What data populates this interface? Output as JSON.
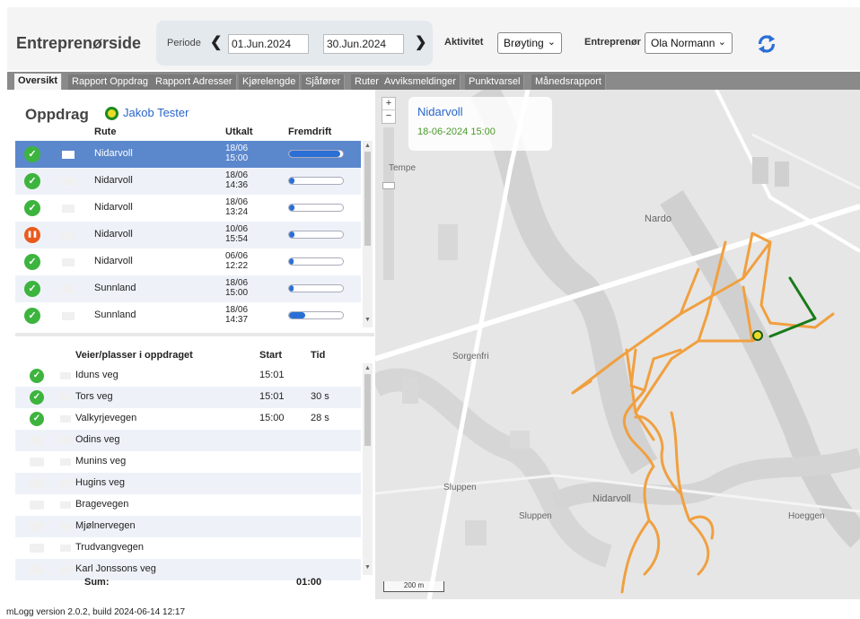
{
  "header": {
    "title": "Entreprenørside",
    "periode_label": "Periode",
    "date_from": "01.Jun.2024",
    "date_to": "30.Jun.2024",
    "aktivitet_label": "Aktivitet",
    "aktivitet_value": "Brøyting",
    "entreprenor_label": "Entreprenør",
    "entreprenor_value": "Ola Normann"
  },
  "tabs": [
    {
      "label": "Oversikt",
      "active": true
    },
    {
      "label": "Rapport Oppdrag"
    },
    {
      "label": "Rapport Adresser"
    },
    {
      "label": "Kjørelengde"
    },
    {
      "label": "Sjåfører"
    },
    {
      "label": "Ruter"
    },
    {
      "label": "Avviksmeldinger"
    },
    {
      "label": "Punktvarsel"
    },
    {
      "label": "Månedsrapport"
    }
  ],
  "oppdrag": {
    "title": "Oppdrag",
    "user": "Jakob Tester",
    "columns": {
      "rute": "Rute",
      "utkalt": "Utkalt",
      "fremdrift": "Fremdrift"
    },
    "rows": [
      {
        "status": "ok",
        "rute": "Nidarvoll",
        "date": "18/06",
        "time": "15:00",
        "progress": 0.95,
        "selected": true
      },
      {
        "status": "ok",
        "rute": "Nidarvoll",
        "date": "18/06",
        "time": "14:36",
        "progress": 0.1
      },
      {
        "status": "ok",
        "rute": "Nidarvoll",
        "date": "18/06",
        "time": "13:24",
        "progress": 0.1
      },
      {
        "status": "pause",
        "rute": "Nidarvoll",
        "date": "10/06",
        "time": "15:54",
        "progress": 0.1
      },
      {
        "status": "ok",
        "rute": "Nidarvoll",
        "date": "06/06",
        "time": "12:22",
        "progress": 0.05
      },
      {
        "status": "ok",
        "rute": "Sunnland",
        "date": "18/06",
        "time": "15:00",
        "progress": 0.05
      },
      {
        "status": "ok",
        "rute": "Sunnland",
        "date": "18/06",
        "time": "14:37",
        "progress": 0.3
      }
    ]
  },
  "veier": {
    "columns": {
      "vei": "Veier/plasser i oppdraget",
      "start": "Start",
      "tid": "Tid"
    },
    "rows": [
      {
        "status": "ok",
        "vei": "Iduns veg",
        "start": "15:01",
        "tid": ""
      },
      {
        "status": "ok",
        "vei": "Tors veg",
        "start": "15:01",
        "tid": "30 s"
      },
      {
        "status": "ok",
        "vei": "Valkyrjevegen",
        "start": "15:00",
        "tid": "28 s"
      },
      {
        "status": "none",
        "vei": "Odins veg",
        "start": "",
        "tid": ""
      },
      {
        "status": "none",
        "vei": "Munins veg",
        "start": "",
        "tid": ""
      },
      {
        "status": "none",
        "vei": "Hugins veg",
        "start": "",
        "tid": ""
      },
      {
        "status": "none",
        "vei": "Bragevegen",
        "start": "",
        "tid": ""
      },
      {
        "status": "none",
        "vei": "Mjølnervegen",
        "start": "",
        "tid": ""
      },
      {
        "status": "none",
        "vei": "Trudvangvegen",
        "start": "",
        "tid": ""
      },
      {
        "status": "none",
        "vei": "Karl Jonssons veg",
        "start": "",
        "tid": ""
      }
    ],
    "sum_label": "Sum:",
    "sum_value": "01:00"
  },
  "map": {
    "info_title": "Nidarvoll",
    "info_time": "18-06-2024 15:00",
    "labels": [
      "Tempe",
      "Nardo",
      "Sorgenfri",
      "Sluppen",
      "Sluppen",
      "Nidarvoll",
      "Hoeggen"
    ],
    "scale": "200 m",
    "route_color": "#f0a040",
    "done_color": "#1a7a1a"
  },
  "footer": "mLogg version 2.0.2, build 2024-06-14 12:17"
}
